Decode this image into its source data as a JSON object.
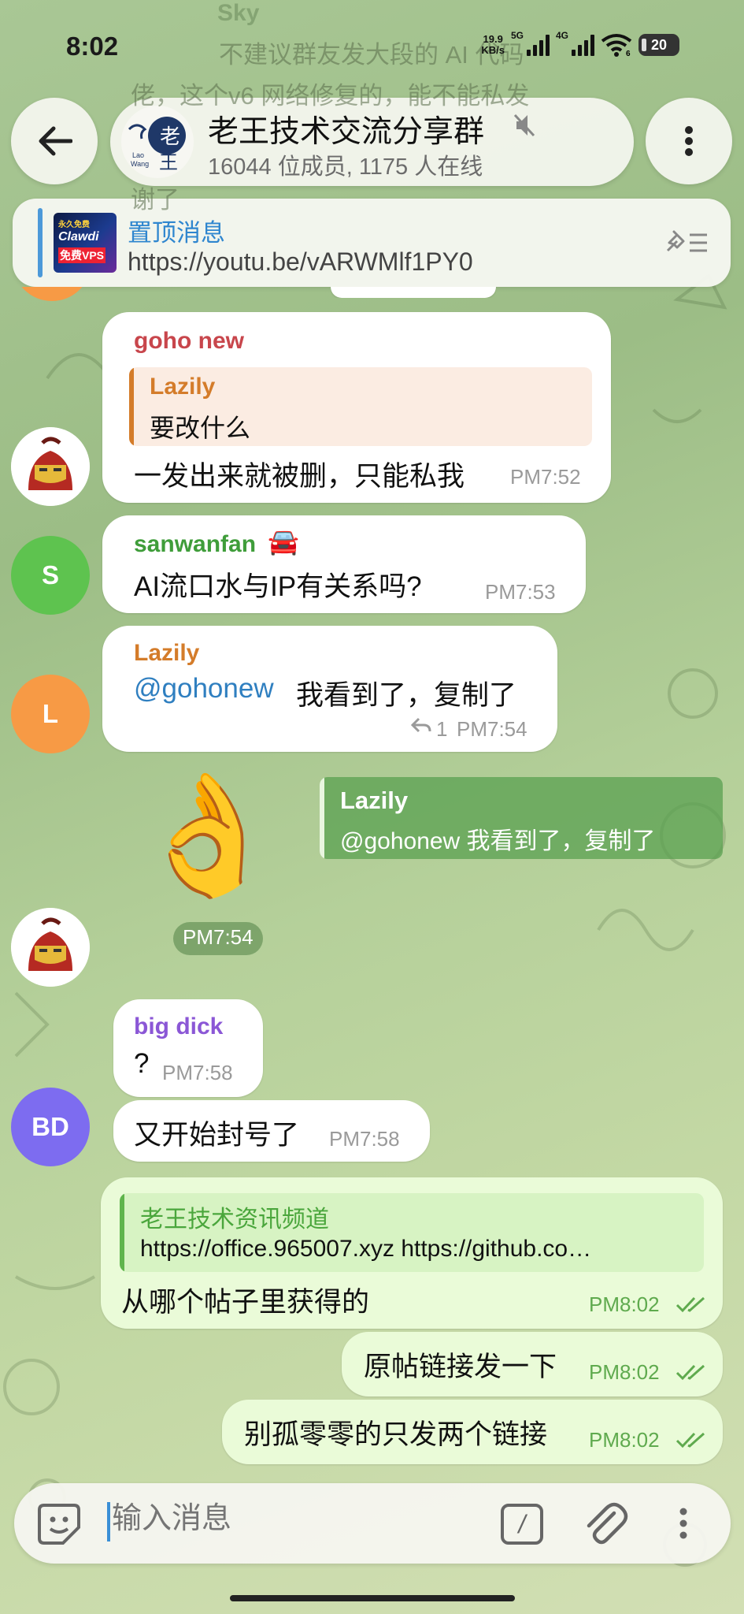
{
  "status_bar": {
    "time": "8:02",
    "net_speed_top": "19.9",
    "net_speed_unit": "KB/s",
    "sim1_label": "5G",
    "sim2_label": "4G",
    "wifi_label": "6",
    "battery": "20"
  },
  "background_peek": {
    "sender": "Sky",
    "line1": "不建议群友发大段的 AI 代码",
    "line2": "佬，这个v6 网络修复的，能不能私发",
    "line3": "谢了"
  },
  "header": {
    "title": "老王技术交流分享群",
    "subtitle": "16044 位成员, 1175 人在线",
    "avatar_char": "老",
    "avatar_char2": "王",
    "avatar_caption1": "Lao",
    "avatar_caption2": "Wang"
  },
  "pinned": {
    "title": "置顶消息",
    "text": "https://youtu.be/vARWMlf1PY0",
    "thumb_line1": "永久免费",
    "thumb_line2": "Clawdi",
    "thumb_line3": "免费VPS"
  },
  "messages": [
    {
      "sender": "goho new",
      "quote_sender": "Lazily",
      "quote_text": "要改什么",
      "text": "一发出来就被删，只能私我",
      "time": "PM7:52"
    },
    {
      "sender": "sanwanfan",
      "sender_emoji": "🚘",
      "text": "AI流口水与IP有关系吗?",
      "time": "PM7:53",
      "avatar": "S"
    },
    {
      "sender": "Lazily",
      "mention": "@gohonew",
      "text": "我看到了，复制了",
      "replies": "1",
      "time": "PM7:54",
      "avatar": "L"
    },
    {
      "sticker": "👌",
      "quote_sender": "Lazily",
      "quote_text": "@gohonew 我看到了，复制了",
      "time": "PM7:54"
    },
    {
      "sender": "big dick",
      "text": "?",
      "time": "PM7:58"
    },
    {
      "text": "又开始封号了",
      "time": "PM7:58",
      "avatar": "BD"
    },
    {
      "quote_sender": "老王技术资讯频道",
      "quote_text": "https://office.965007.xyz  https://github.co…",
      "text": "从哪个帖子里获得的",
      "time": "PM8:02"
    },
    {
      "text": "原帖链接发一下",
      "time": "PM8:02"
    },
    {
      "text": "别孤零零的只发两个链接",
      "time": "PM8:02"
    }
  ],
  "input": {
    "placeholder": "输入消息",
    "command_glyph": "/"
  },
  "colors": {
    "name_red": "#c8464c",
    "name_orange": "#d47c2a",
    "name_green": "#3f9d3a",
    "name_purple": "#8b57d6",
    "link_blue": "#2f7fc0",
    "outgoing_bubble": "#eafbd8",
    "avatar_green": "#5ec34f",
    "avatar_orange": "#f79a45",
    "avatar_purple": "#7d6cf0"
  }
}
